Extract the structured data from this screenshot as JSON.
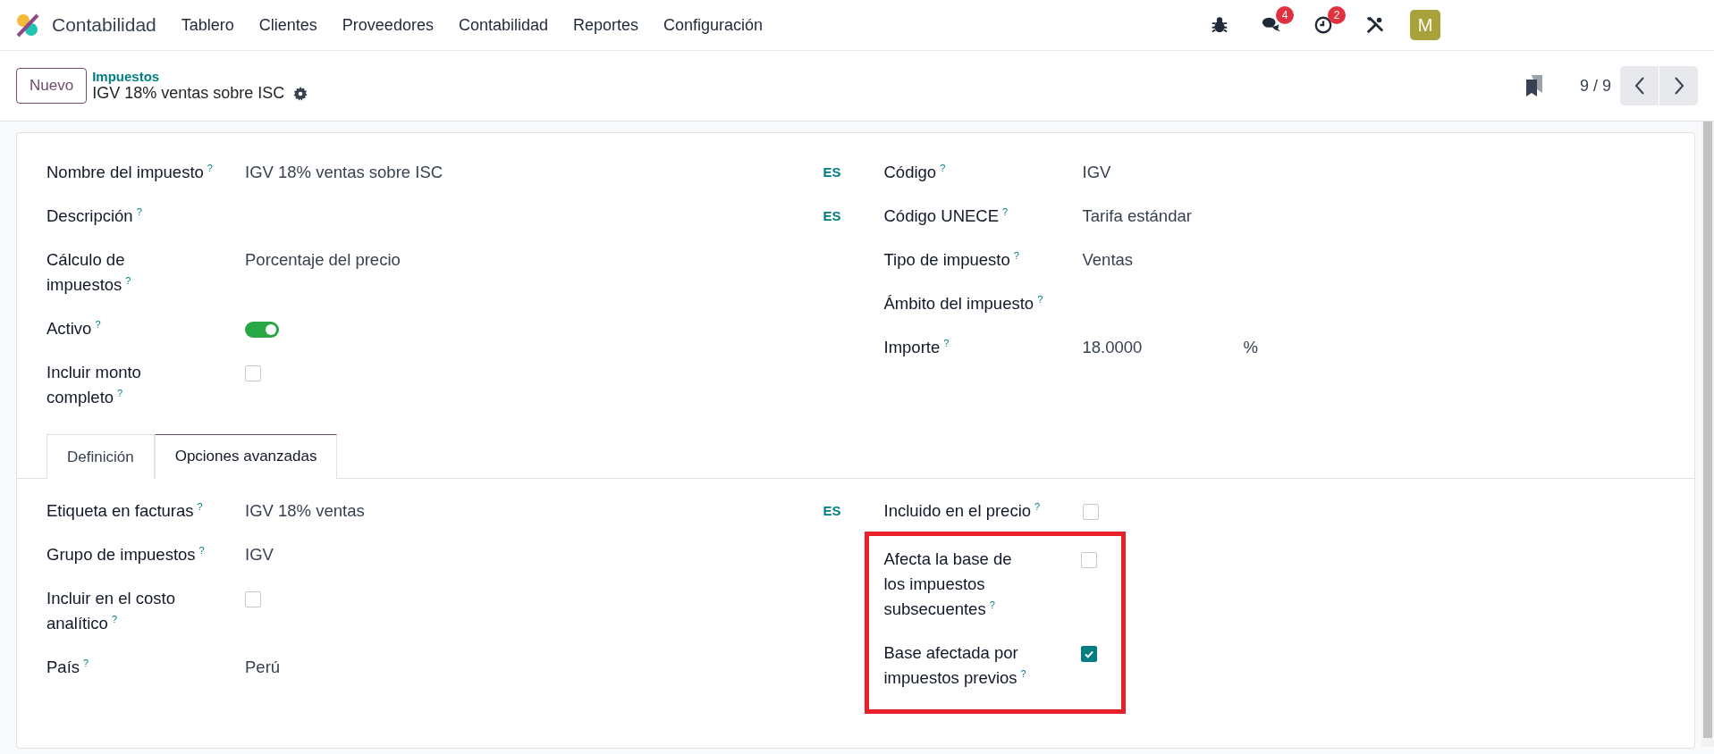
{
  "navbar": {
    "app_name": "Contabilidad",
    "menu": [
      "Tablero",
      "Clientes",
      "Proveedores",
      "Contabilidad",
      "Reportes",
      "Configuración"
    ],
    "systray": [
      {
        "kind": "bug"
      },
      {
        "kind": "chat",
        "badge": "4"
      },
      {
        "kind": "clock",
        "badge": "2"
      },
      {
        "kind": "tools"
      }
    ],
    "avatar": "M"
  },
  "control_panel": {
    "new_button": "Nuevo",
    "breadcrumb": "Impuestos",
    "record_title": "IGV 18% ventas sobre ISC",
    "pager": "9 / 9"
  },
  "form": {
    "left": [
      {
        "kind": "text",
        "label": "Nombre del impuesto",
        "help": "?",
        "value": "IGV 18% ventas sobre ISC",
        "lang": "ES"
      },
      {
        "kind": "text",
        "label": "Descripción",
        "help": "?",
        "lang": "ES"
      },
      {
        "kind": "text",
        "label": "Cálculo de impuestos",
        "help": "?",
        "value": "Porcentaje del precio"
      },
      {
        "kind": "toggle",
        "label": "Activo",
        "help": "?",
        "on": true
      },
      {
        "kind": "checkbox",
        "label": "Incluir monto completo",
        "help": "?",
        "checked": false
      }
    ],
    "right": [
      {
        "kind": "text",
        "label": "Código",
        "help": "?",
        "value": "IGV"
      },
      {
        "kind": "text",
        "label": "Código UNECE",
        "help": "?",
        "value": "Tarifa estándar"
      },
      {
        "kind": "text",
        "label": "Tipo de impuesto",
        "help": "?",
        "value": "Ventas"
      },
      {
        "kind": "text",
        "label": "Ámbito del impuesto",
        "help": "?"
      },
      {
        "kind": "text",
        "label": "Importe",
        "help": "?",
        "value": "18.0000",
        "suffix": "%"
      }
    ]
  },
  "tabs": [
    {
      "label": "Definición",
      "selected": false
    },
    {
      "label": "Opciones avanzadas",
      "selected": true
    }
  ],
  "advanced": {
    "left": [
      {
        "kind": "text",
        "label": "Etiqueta en facturas",
        "help": "?",
        "value": "IGV 18% ventas",
        "lang": "ES"
      },
      {
        "kind": "text",
        "label": "Grupo de impuestos",
        "help": "?",
        "value": "IGV"
      },
      {
        "kind": "checkbox",
        "label": "Incluir en el costo analítico",
        "help": "?",
        "checked": false
      },
      {
        "kind": "text",
        "label": "País",
        "help": "?",
        "value": "Perú"
      }
    ],
    "right": [
      {
        "kind": "checkbox",
        "label": "Incluido en el precio",
        "help": "?",
        "checked": false
      },
      {
        "kind": "highlight",
        "fields": [
          {
            "kind": "checkbox",
            "label": "Afecta la base de los impuestos subsecuentes",
            "help": "?",
            "checked": false
          },
          {
            "kind": "checkbox",
            "label": "Base afectada por impuestos previos",
            "help": "?",
            "checked": true
          }
        ]
      }
    ]
  }
}
